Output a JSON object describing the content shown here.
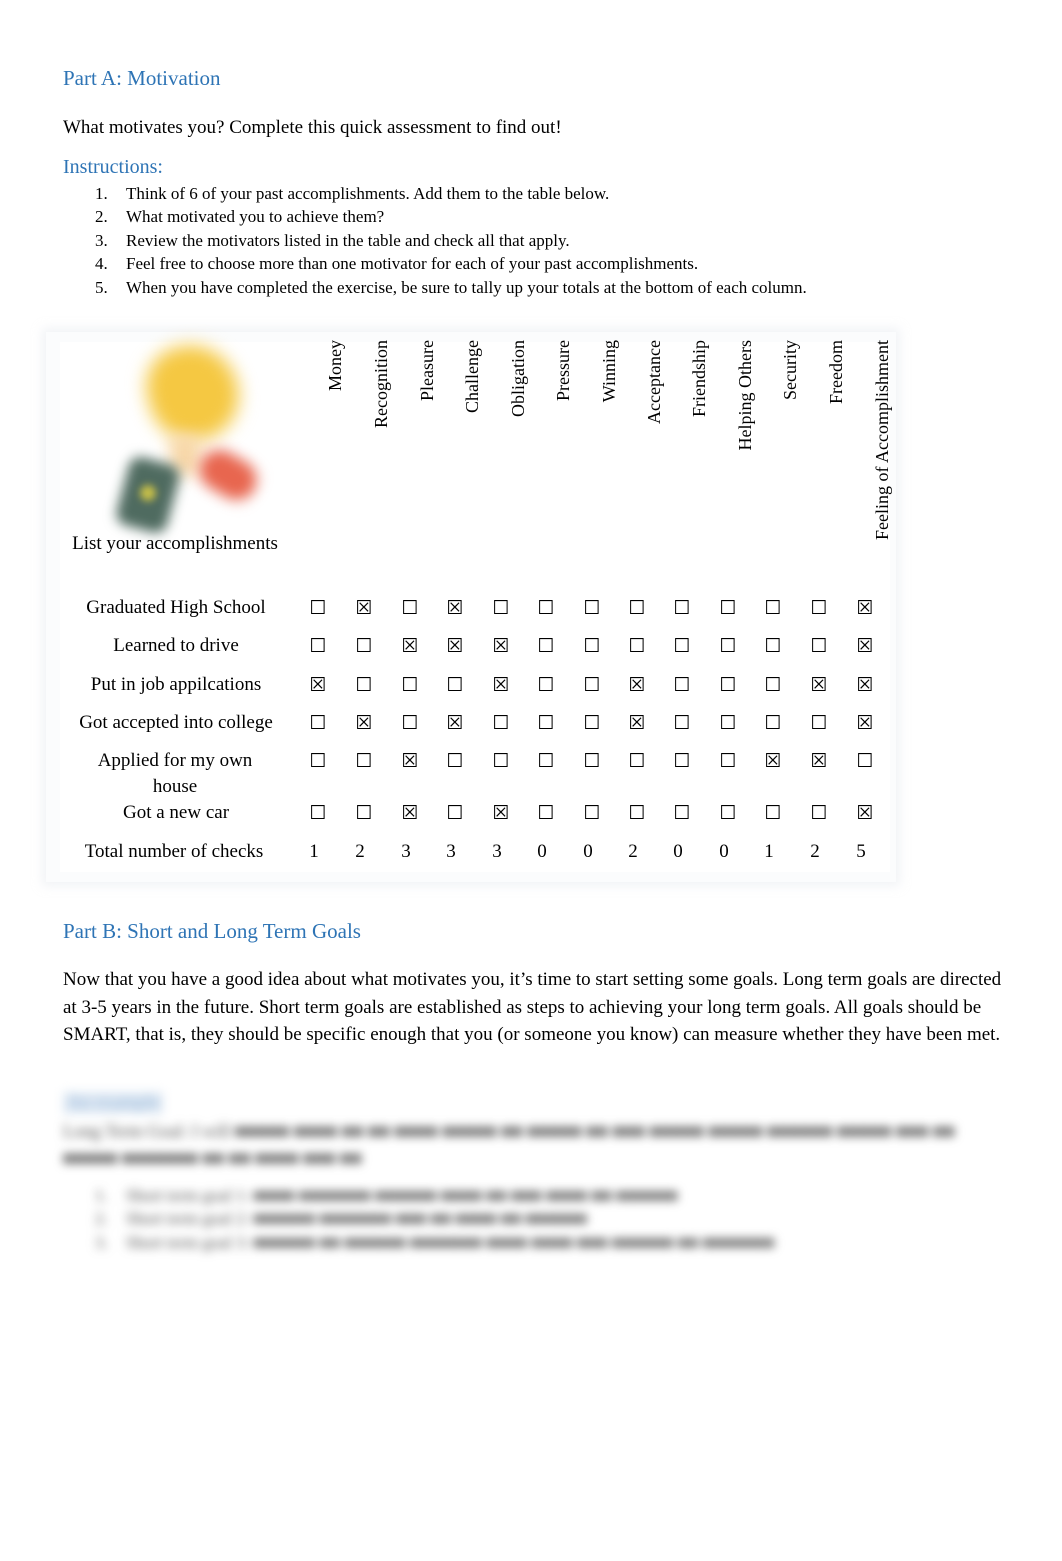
{
  "part_a": {
    "heading": "Part A: Motivation",
    "intro": "What motivates you? Complete this quick assessment to find out!",
    "instructions_heading": "Instructions:",
    "instructions": [
      {
        "num": "1.",
        "text": "Think of 6 of your past accomplishments. Add them to the table below."
      },
      {
        "num": "2.",
        "text": "What motivated you to achieve them?"
      },
      {
        "num": "3.",
        "text": "Review the motivators listed in the table and check all that apply."
      },
      {
        "num": "4.",
        "text": "Feel free to choose more than one motivator for each of your past accomplishments."
      },
      {
        "num": "5.",
        "text": "When you have completed the exercise, be sure to tally up your totals at the bottom of each column."
      }
    ]
  },
  "table": {
    "image": "trophy-icon",
    "accomplishments_header": "List your accomplishments",
    "columns": [
      "Money",
      "Recognition",
      "Pleasure",
      "Challenge",
      "Obligation",
      "Pressure",
      "Winning",
      "Acceptance",
      "Friendship",
      "Helping Others",
      "Security",
      "Freedom",
      "Feeling of Accomplishment"
    ],
    "checked_glyph": "☒",
    "unchecked_glyph": "☐",
    "rows": [
      {
        "label": "Graduated High School",
        "checks": [
          0,
          1,
          0,
          1,
          0,
          0,
          0,
          0,
          0,
          0,
          0,
          0,
          1
        ]
      },
      {
        "label": "Learned to drive",
        "checks": [
          0,
          0,
          1,
          1,
          1,
          0,
          0,
          0,
          0,
          0,
          0,
          0,
          1
        ]
      },
      {
        "label": "Put in job appilcations",
        "checks": [
          1,
          0,
          0,
          0,
          1,
          0,
          0,
          1,
          0,
          0,
          0,
          1,
          1
        ]
      },
      {
        "label": "Got accepted into college",
        "checks": [
          0,
          1,
          0,
          1,
          0,
          0,
          0,
          1,
          0,
          0,
          0,
          0,
          1
        ]
      },
      {
        "label": "Applied for my own house",
        "checks": [
          0,
          0,
          1,
          0,
          0,
          0,
          0,
          0,
          0,
          0,
          1,
          1,
          0
        ]
      },
      {
        "label": "Got a new car",
        "checks": [
          0,
          0,
          1,
          0,
          1,
          0,
          0,
          0,
          0,
          0,
          0,
          0,
          1
        ]
      }
    ],
    "totals_label": "Total number of checks",
    "totals": [
      "1",
      "2",
      "3",
      "3",
      "3",
      "0",
      "0",
      "2",
      "0",
      "0",
      "1",
      "2",
      "5"
    ]
  },
  "part_b": {
    "heading": "Part B: Short and Long Term Goals",
    "body": "Now that you have a good idea about what motivates you, it’s time to start setting some goals. Long term goals are directed at 3-5 years in the future.    Short term goals are established as steps to achieving your long term goals.  All goals should be SMART, that is, they should be specific enough that you (or someone you know) can measure whether they have been met.",
    "blurred_link": "An example",
    "blurred_text": "Long Term Goal: I will ■■■■■ ■■■■ ■■ ■■ ■■■■ ■■■■■ ■■ ■■■■■ ■■ ■■■ ■■■■■ ■■■■■ ■■■■■■ ■■■■■ ■■■ ■■ ■■■■■ ■■■■■■■ ■■ ■■ ■■■■ ■■■ ■■",
    "blurred_items": [
      {
        "num": "1.",
        "text": "Short term goal 1: ■■■■ ■■■■■■■ ■■■■■■ ■■■■ ■■ ■■■ ■■■■ ■■ ■■■■■■"
      },
      {
        "num": "2.",
        "text": "Short term goal 2: ■■■■■■ ■■■■■■■ ■■■ ■■ ■■■■ ■■ ■■■■■■"
      },
      {
        "num": "3.",
        "text": "Short term goal 3: ■■■■■■ ■■ ■■■■■■ ■■■■■■■ ■■■■ ■■■■ ■■■ ■■■■■■ ■■ ■■■■■■■"
      }
    ]
  }
}
